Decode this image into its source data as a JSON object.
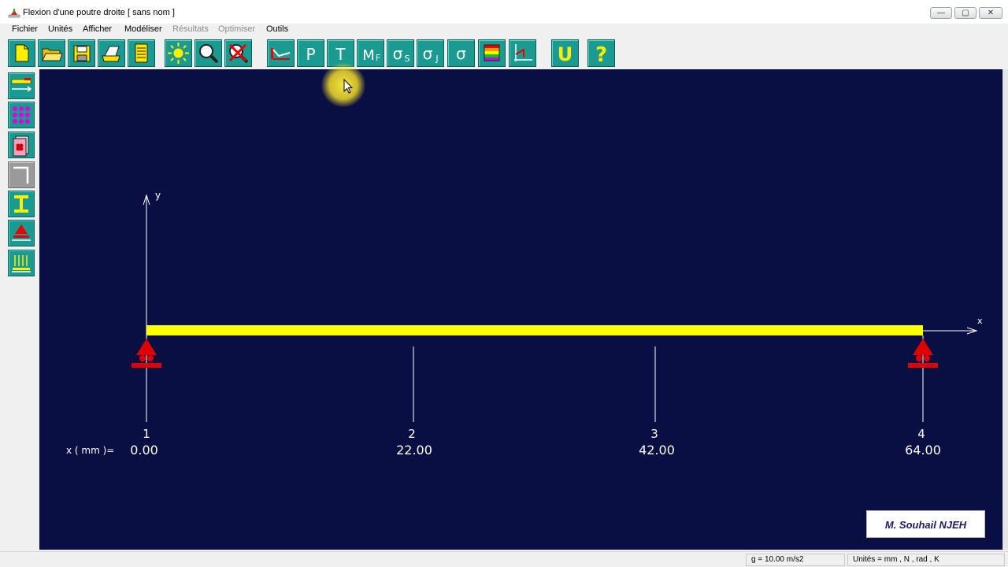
{
  "window": {
    "title": "Flexion d'une poutre droite    [ sans nom ]",
    "controls": [
      "minimize",
      "maximize",
      "close"
    ]
  },
  "menu": [
    {
      "label": "Fichier",
      "enabled": true
    },
    {
      "label": "Unités",
      "enabled": true
    },
    {
      "label": "Afficher",
      "enabled": true
    },
    {
      "label": "Modéliser",
      "enabled": true
    },
    {
      "label": "Résultats",
      "enabled": false
    },
    {
      "label": "Optimiser",
      "enabled": false
    },
    {
      "label": "Outils",
      "enabled": true
    }
  ],
  "toolbar": {
    "buttons": [
      {
        "name": "new-file-icon"
      },
      {
        "name": "open-folder-icon"
      },
      {
        "name": "save-disk-icon"
      },
      {
        "name": "print-icon"
      },
      {
        "name": "notepad-icon"
      },
      {
        "name": "sun-icon"
      },
      {
        "name": "zoom-magnifier-icon"
      },
      {
        "name": "zoom-cancel-icon"
      },
      {
        "name": "deflection-curve-icon"
      },
      {
        "name": "p-icon",
        "text": "P"
      },
      {
        "name": "shear-t-icon",
        "text": "T"
      },
      {
        "name": "bending-moment-icon",
        "text": "M",
        "sub": "F"
      },
      {
        "name": "sigma-s-icon",
        "text": "σ",
        "sub": "S"
      },
      {
        "name": "sigma-j-icon",
        "text": "σ",
        "sub": "J"
      },
      {
        "name": "sigma-icon",
        "text": "σ"
      },
      {
        "name": "color-scale-icon"
      },
      {
        "name": "axes-icon"
      },
      {
        "name": "u-profile-icon",
        "text": "U"
      },
      {
        "name": "help-question-icon",
        "text": "?"
      }
    ]
  },
  "sidebar": {
    "buttons": [
      {
        "name": "beam-length-icon"
      },
      {
        "name": "material-grid-icon"
      },
      {
        "name": "material-book-icon"
      },
      {
        "name": "corner-section-icon"
      },
      {
        "name": "i-beam-section-icon"
      },
      {
        "name": "support-icon"
      },
      {
        "name": "distributed-load-icon"
      }
    ]
  },
  "diagram": {
    "axis_x_label": "x",
    "axis_y_label": "y",
    "x_prefix": "x ( mm )=",
    "nodes": [
      {
        "number": "1",
        "x": "0.00",
        "support": true
      },
      {
        "number": "2",
        "x": "22.00",
        "support": false
      },
      {
        "number": "3",
        "x": "42.00",
        "support": false
      },
      {
        "number": "4",
        "x": "64.00",
        "support": true
      }
    ],
    "colors": {
      "background": "#0a0f43",
      "beam": "#ffff00",
      "support": "#e10000",
      "lines": "#ffffff"
    }
  },
  "signature": "M. Souhail NJEH",
  "status": {
    "gravity": "g = 10.00 m/s2",
    "units": "Unités = mm ,  N , rad ,  K"
  }
}
